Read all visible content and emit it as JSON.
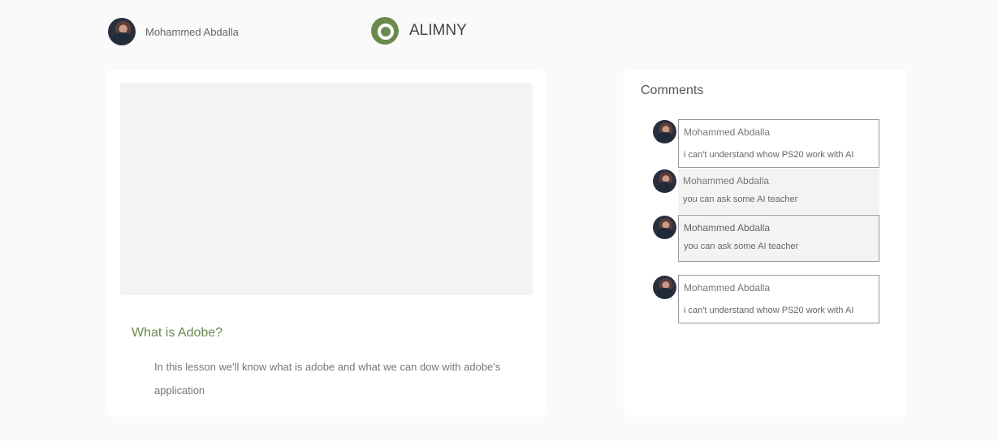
{
  "header": {
    "user_name": "Mohammed Abdalla",
    "brand_name": "ALIMNY"
  },
  "lesson": {
    "title": "What is Adobe?",
    "description": "In this lesson we'll know what is adobe and what we can dow with adobe's application"
  },
  "comments": {
    "title": "Comments",
    "items": [
      {
        "author": "Mohammed Abdalla",
        "text": "i can't understand whow PS20 work with AI"
      },
      {
        "author": "Mohammed Abdalla",
        "text": "you can ask some AI teacher"
      },
      {
        "author": "Mohammed Abdalla",
        "text": "you can ask some AI teacher"
      },
      {
        "author": "Mohammed Abdalla",
        "text": "i can't understand whow PS20 work with AI"
      }
    ]
  },
  "colors": {
    "accent": "#6a8a4d",
    "background": "#fafafa"
  }
}
